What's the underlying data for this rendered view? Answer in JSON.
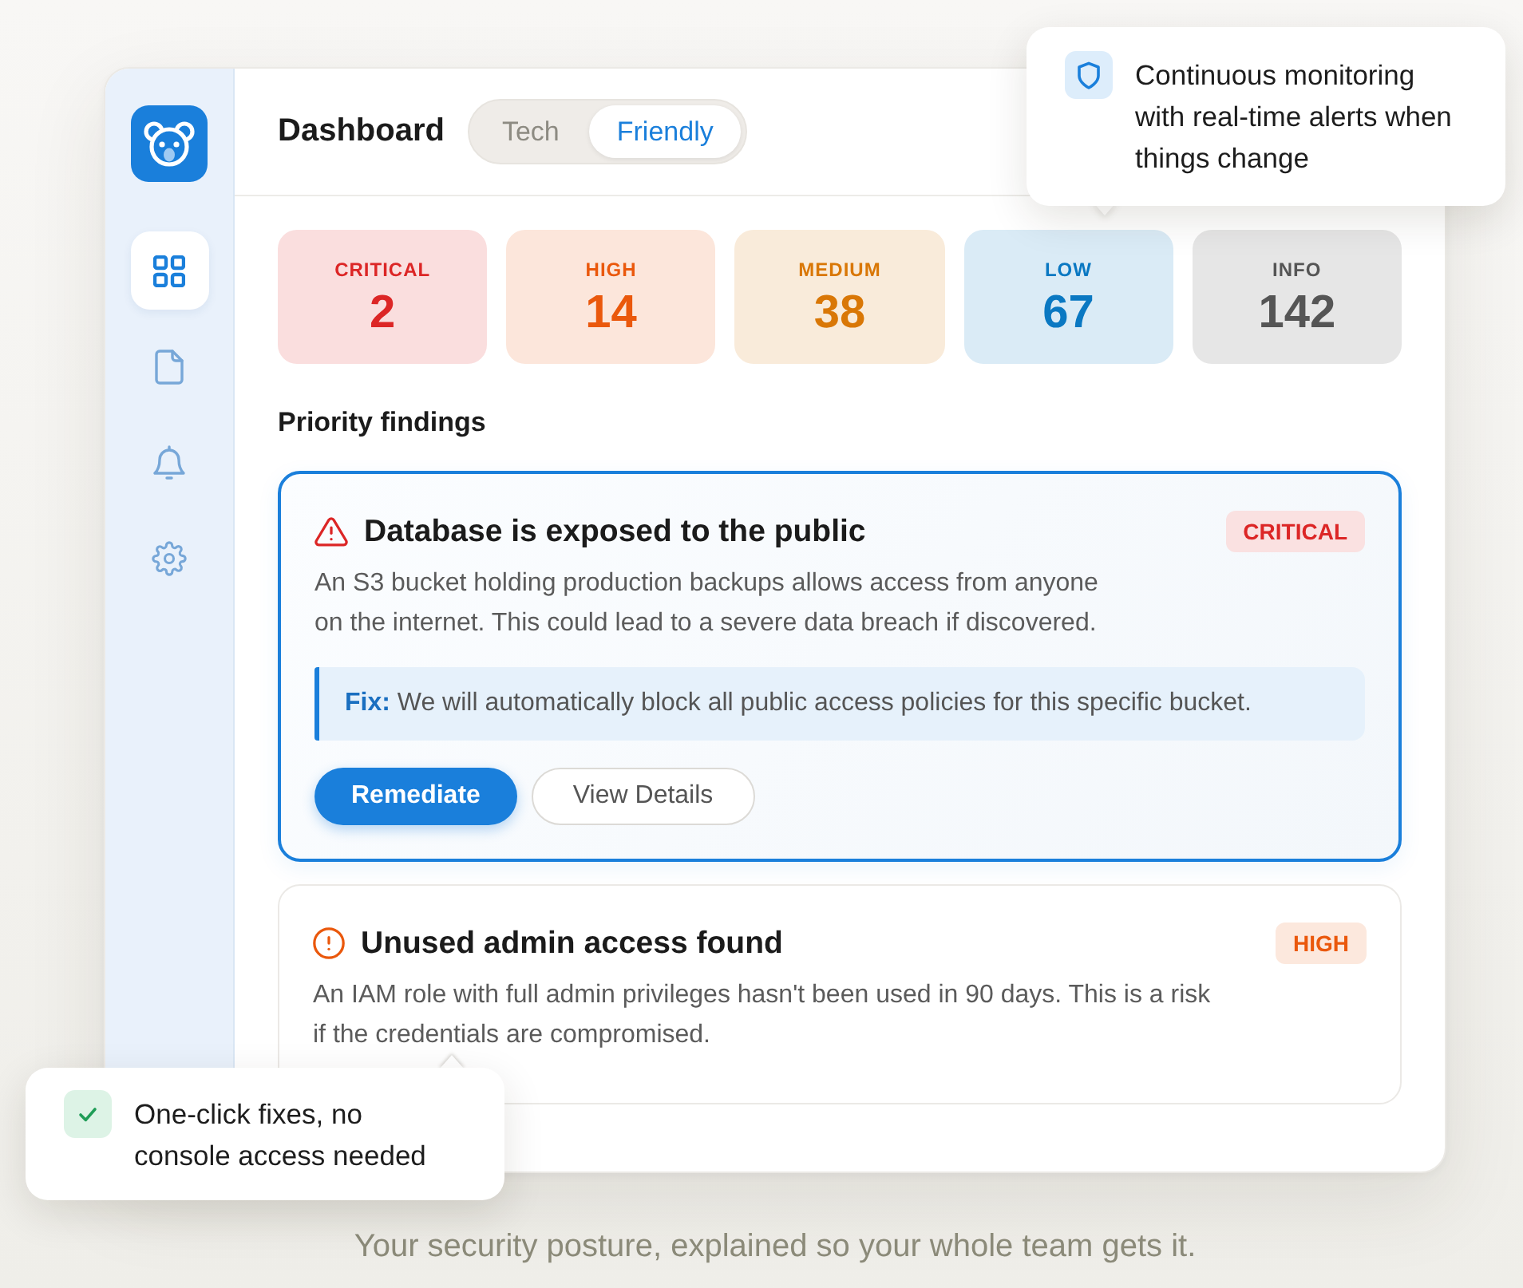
{
  "app": {
    "title": "Dashboard",
    "view_toggle": [
      {
        "label": "Tech",
        "selected": false
      },
      {
        "label": "Friendly",
        "selected": true
      }
    ]
  },
  "sidebar": {
    "items": [
      {
        "kind": "dashboard",
        "selected": true
      },
      {
        "kind": "documents",
        "selected": false
      },
      {
        "kind": "notifications",
        "selected": false
      },
      {
        "kind": "settings",
        "selected": false
      }
    ]
  },
  "severity_summary": [
    {
      "label": "CRITICAL",
      "count": "2",
      "color": "#dc2626"
    },
    {
      "label": "HIGH",
      "count": "14",
      "color": "#ea580c"
    },
    {
      "label": "MEDIUM",
      "count": "38",
      "color": "#d97706"
    },
    {
      "label": "LOW",
      "count": "67",
      "color": "#0a78c2"
    },
    {
      "label": "INFO",
      "count": "142",
      "color": "#555555"
    }
  ],
  "findings": {
    "heading": "Priority findings",
    "items": [
      {
        "kind": "warning",
        "title": "Database is exposed to the public",
        "severity": "CRITICAL",
        "color": "#dc2626",
        "selected": true,
        "description": "An S3 bucket holding production backups allows access from anyone on the internet. This could lead to a severe data breach if discovered.",
        "fix": "**Fix:** We will automatically block all public access policies for this specific bucket.",
        "actions": [
          {
            "label": "Remediate",
            "kind": "primary"
          },
          {
            "label": "View Details",
            "kind": "secondary"
          }
        ]
      },
      {
        "kind": "notice",
        "title": "Unused admin access found",
        "severity": "HIGH",
        "color": "#ea580c",
        "selected": false,
        "description": "An IAM role with full admin privileges hasn't been used in 90 days. This is a risk if the credentials are compromised."
      }
    ]
  },
  "callouts": [
    {
      "kind": "monitoring",
      "text": "Continuous monitoring with real-time alerts when things change"
    },
    {
      "kind": "remediation",
      "text": "One-click fixes, no console access needed"
    }
  ],
  "tagline": "Your security posture, explained so your whole team gets it."
}
